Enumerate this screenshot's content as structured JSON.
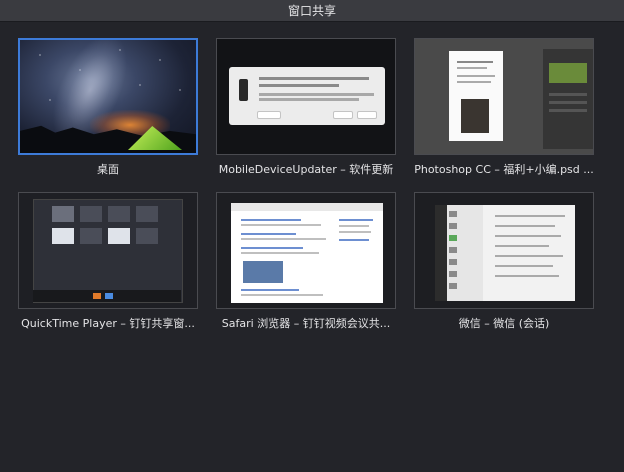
{
  "window": {
    "title": "窗口共享"
  },
  "tiles": [
    {
      "caption": "桌面",
      "selected": true
    },
    {
      "caption": "MobileDeviceUpdater – 软件更新",
      "selected": false
    },
    {
      "caption": "Photoshop CC – 福利+小编.psd ...",
      "selected": false
    },
    {
      "caption": "QuickTime Player – 钉钉共享窗...",
      "selected": false
    },
    {
      "caption": "Safari 浏览器 – 钉钉视频会议共...",
      "selected": false
    },
    {
      "caption": "微信 – 微信 (会话)",
      "selected": false
    }
  ],
  "colors": {
    "background": "#232429",
    "titlebar": "#3a3b40",
    "selection": "#3d7bd8"
  }
}
